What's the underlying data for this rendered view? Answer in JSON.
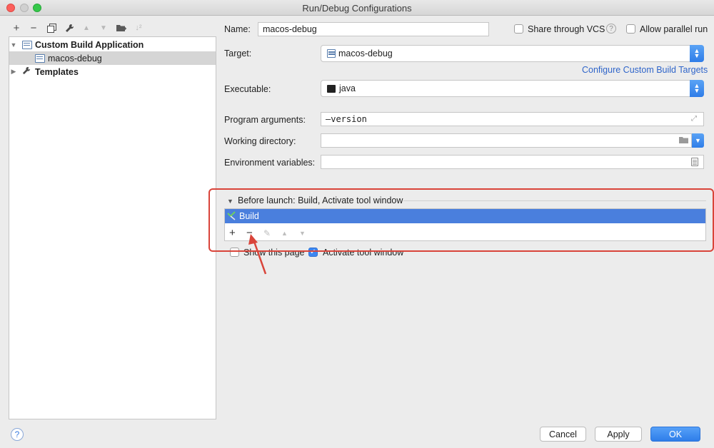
{
  "window": {
    "title": "Run/Debug Configurations"
  },
  "toolbar": {
    "icons": [
      "add-icon",
      "remove-icon",
      "copy-icon",
      "wrench-icon",
      "move-up-icon",
      "move-down-icon",
      "folder-add-icon",
      "sort-icon"
    ]
  },
  "tree": {
    "items": [
      {
        "label": "Custom Build Application",
        "expanded": true
      },
      {
        "label": "macos-debug",
        "selected": true
      },
      {
        "label": "Templates",
        "expanded": false
      }
    ]
  },
  "form": {
    "name_label": "Name:",
    "name_value": "macos-debug",
    "share_vcs_label": "Share through VCS",
    "allow_parallel_label": "Allow parallel run",
    "target_label": "Target:",
    "target_value": "macos-debug",
    "configure_link": "Configure Custom Build Targets",
    "executable_label": "Executable:",
    "executable_value": "java",
    "program_args_label": "Program arguments:",
    "program_args_value": "–version",
    "working_dir_label": "Working directory:",
    "working_dir_value": "",
    "env_vars_label": "Environment variables:",
    "env_vars_value": ""
  },
  "before_launch": {
    "header": "Before launch: Build, Activate tool window",
    "tasks": [
      {
        "label": "Build"
      }
    ],
    "show_page_label": "Show this page",
    "show_page_checked": false,
    "activate_tool_label": "Activate tool window",
    "activate_tool_checked": true
  },
  "buttons": {
    "cancel": "Cancel",
    "apply": "Apply",
    "ok": "OK"
  },
  "colors": {
    "selection": "#4a7fdd",
    "annotation": "#d9443a",
    "link": "#2f65ca"
  }
}
